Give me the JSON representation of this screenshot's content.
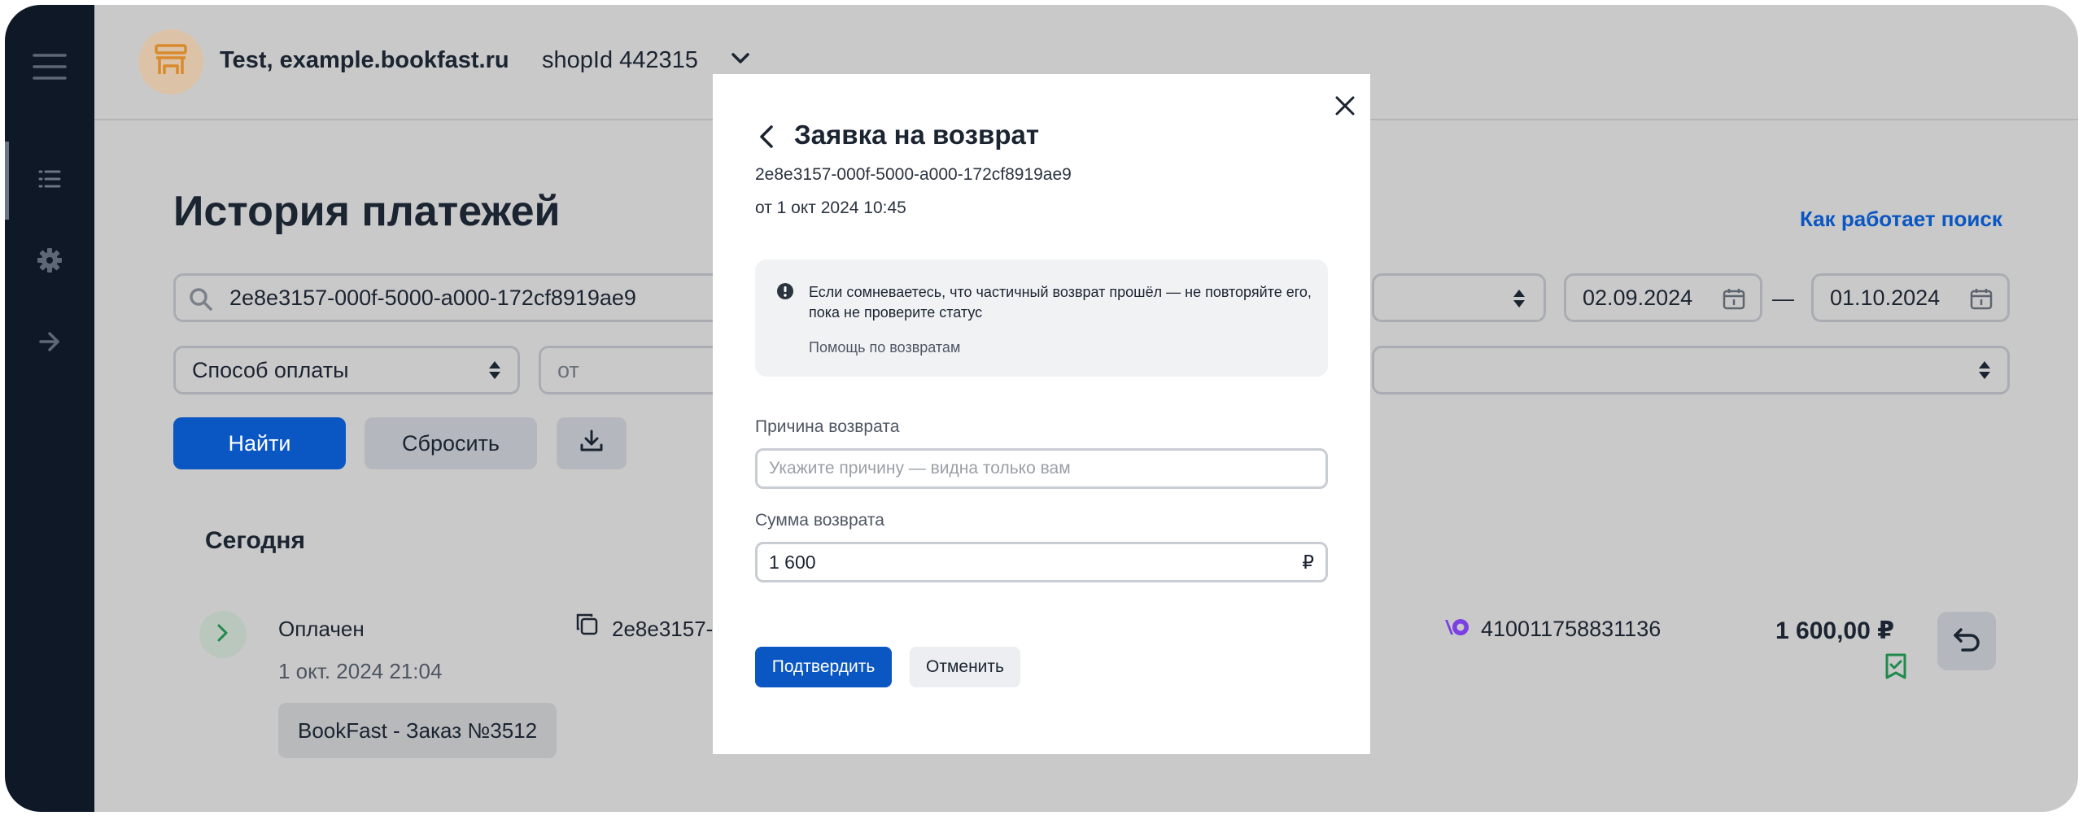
{
  "shop": {
    "name": "Test, example.bookfast.ru",
    "id_label": "shopId 442315"
  },
  "page": {
    "title": "История платежей",
    "help_link": "Как работает поиск"
  },
  "filters": {
    "search_value": "2e8e3157-000f-5000-a000-172cf8919ae9",
    "date_from": "02.09.2024",
    "date_separator": "—",
    "date_to": "01.10.2024",
    "payment_method": "Способ оплаты",
    "amount_from_placeholder": "от",
    "find_button": "Найти",
    "reset_button": "Сбросить"
  },
  "payments": {
    "section_title": "Сегодня",
    "rows": [
      {
        "status": "Оплачен",
        "date": "1 окт. 2024 21:04",
        "id_short": "2e8e3157-",
        "description": "BookFast - Заказ №3512",
        "wallet": "410011758831136",
        "amount": "1 600,00 ₽"
      }
    ]
  },
  "modal": {
    "title": "Заявка на возврат",
    "payment_id": "2e8e3157-000f-5000-a000-172cf8919ae9",
    "payment_date": "от 1 окт 2024 10:45",
    "notice_text": "Если сомневаетесь, что частичный возврат прошёл — не повторяйте его, пока не проверите статус",
    "notice_link": "Помощь по возвратам",
    "reason_label": "Причина возврата",
    "reason_placeholder": "Укажите причину — видна только вам",
    "amount_label": "Сумма возврата",
    "amount_value": "1 600",
    "currency": "₽",
    "confirm_button": "Подтвердить",
    "cancel_button": "Отменить"
  },
  "colors": {
    "sidebar": "#0e1827",
    "overlay": "#c9c9c9",
    "primary": "#0a56c2",
    "accent_purple": "#7b3fe4",
    "status_green": "#1f8a4c"
  }
}
